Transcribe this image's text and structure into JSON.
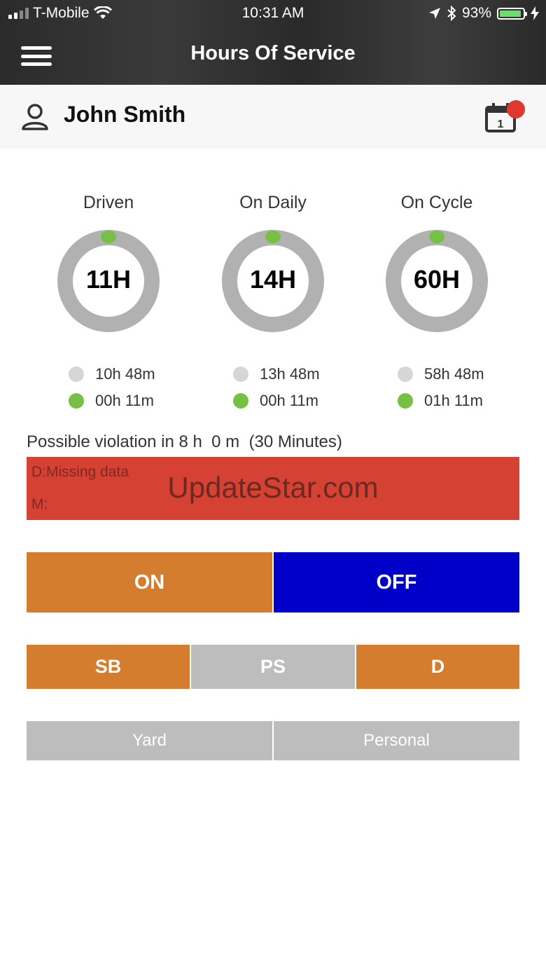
{
  "status_bar": {
    "carrier": "T-Mobile",
    "time": "10:31 AM",
    "battery": "93%",
    "battery_level": 0.93,
    "battery_color": "#6ae06a"
  },
  "nav": {
    "title": "Hours Of Service",
    "menu_icon": "hamburger-icon"
  },
  "user": {
    "name": "John Smith",
    "icon": "user-icon",
    "calendar_icon": "calendar-icon",
    "calendar_number": "1"
  },
  "gauges": [
    {
      "title": "Driven",
      "value": "11H",
      "remaining": "10h 48m",
      "used": "00h 11m"
    },
    {
      "title": "On Daily",
      "value": "14H",
      "remaining": "13h 48m",
      "used": "00h 11m"
    },
    {
      "title": "On Cycle",
      "value": "60H",
      "remaining": "58h 48m",
      "used": "01h 11m"
    }
  ],
  "violation": {
    "text": "Possible violation in 8 h  0 m  (30 Minutes)"
  },
  "alert": {
    "line1": "D:Missing data",
    "line2": "M:",
    "watermark": "UpdateStar.com",
    "color": "#d54132"
  },
  "duty": {
    "on": "ON",
    "off": "OFF",
    "sb": "SB",
    "ps": "PS",
    "d": "D",
    "yard": "Yard",
    "personal": "Personal"
  },
  "colors": {
    "orange": "#d47d2f",
    "blue": "#0000c8",
    "gray": "#bdbdbd",
    "green": "#76c043"
  }
}
